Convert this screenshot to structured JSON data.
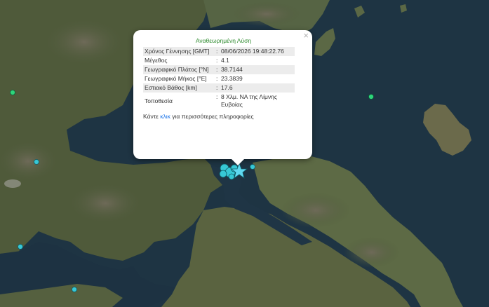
{
  "popup": {
    "title": "Αναθεωρημένη Λύση",
    "close": "×",
    "separator": ":",
    "rows": [
      {
        "label": "Χρόνος Γέννησης [GMT]",
        "value": "08/06/2026 19:48:22.76"
      },
      {
        "label": "Μέγεθος",
        "value": "4.1"
      },
      {
        "label": "Γεωγραφικό Πλάτος [°N]",
        "value": "38.7144"
      },
      {
        "label": "Γεωγραφικό Μήκος [°E]",
        "value": "23.3839"
      },
      {
        "label": "Εστιακό Βάθος [km]",
        "value": "17.6"
      },
      {
        "label": "Τοποθεσία",
        "value": "8 Χλμ. ΝΑ της Λίμνης Ευβοίας"
      }
    ],
    "footer": {
      "before": "Κάντε ",
      "link": "κλικ",
      "after": " για περισσότερες πληροφορίες"
    }
  },
  "colors": {
    "marker": "#37c8d6",
    "star": "#5fd8f0",
    "title": "#2e8b2e",
    "link": "#1a73e8"
  },
  "map": {
    "type": "satellite",
    "region": "Central Greece / Evia"
  }
}
